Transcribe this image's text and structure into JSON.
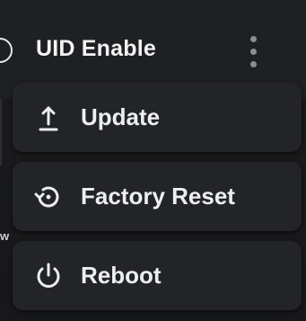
{
  "header": {
    "title": "UID Enable",
    "menu_icon": "kebab-vertical-icon"
  },
  "menu": {
    "items": [
      {
        "label": "Update",
        "icon": "upload-arrow-icon"
      },
      {
        "label": "Factory Reset",
        "icon": "factory-reset-icon"
      },
      {
        "label": "Reboot",
        "icon": "power-icon"
      }
    ]
  },
  "colors": {
    "background": "#1b1c1e",
    "menu_item": "#232427",
    "text": "#eceef1",
    "kebab": "#8a8d93"
  }
}
